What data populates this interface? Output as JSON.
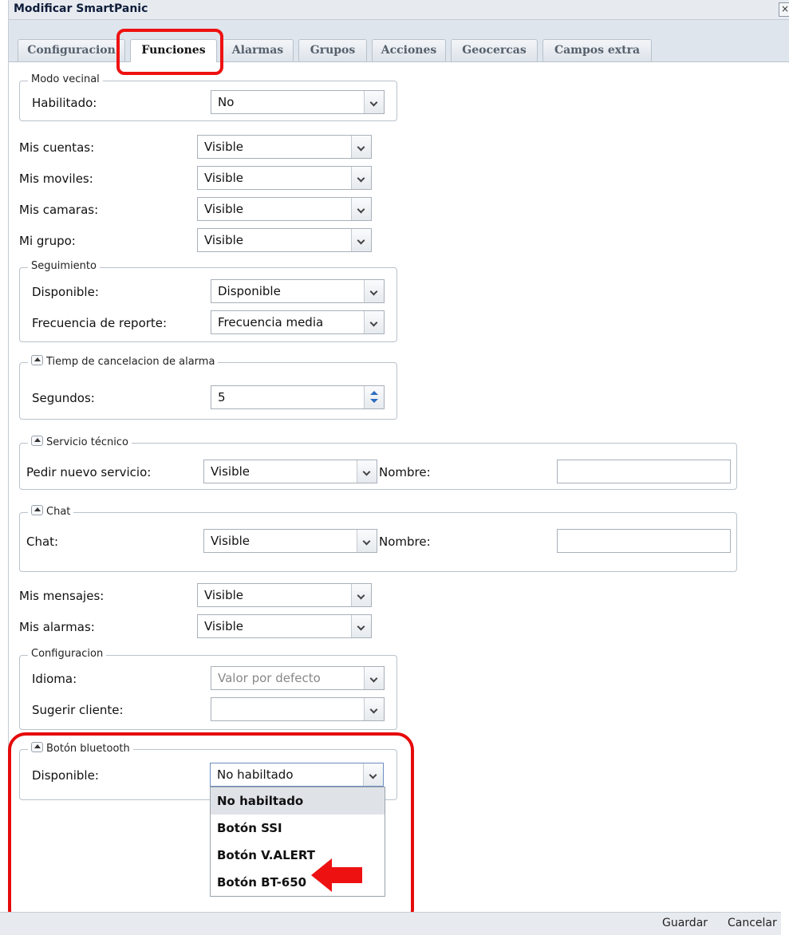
{
  "window": {
    "title": "Modificar SmartPanic",
    "close_label": "×"
  },
  "tabs": [
    {
      "label": "Configuracion"
    },
    {
      "label": "Funciones",
      "active": true
    },
    {
      "label": "Alarmas"
    },
    {
      "label": "Grupos"
    },
    {
      "label": "Acciones"
    },
    {
      "label": "Geocercas"
    },
    {
      "label": "Campos extra"
    }
  ],
  "modo_vecinal": {
    "legend": "Modo vecinal",
    "habilitado_label": "Habilitado:",
    "habilitado_value": "No"
  },
  "mis": {
    "cuentas_label": "Mis cuentas:",
    "cuentas_value": "Visible",
    "moviles_label": "Mis moviles:",
    "moviles_value": "Visible",
    "camaras_label": "Mis camaras:",
    "camaras_value": "Visible",
    "grupo_label": "Mi grupo:",
    "grupo_value": "Visible"
  },
  "seguimiento": {
    "legend": "Seguimiento",
    "disponible_label": "Disponible:",
    "disponible_value": "Disponible",
    "frecuencia_label": "Frecuencia de reporte:",
    "frecuencia_value": "Frecuencia media"
  },
  "cancelacion": {
    "legend": "Tiemp de cancelacion de alarma",
    "segundos_label": "Segundos:",
    "segundos_value": "5"
  },
  "servicio_tecnico": {
    "legend": "Servicio técnico",
    "pedir_label": "Pedir nuevo servicio:",
    "pedir_value": "Visible",
    "nombre_label": "Nombre:",
    "nombre_value": ""
  },
  "chat": {
    "legend": "Chat",
    "chat_label": "Chat:",
    "chat_value": "Visible",
    "nombre_label": "Nombre:",
    "nombre_value": ""
  },
  "mensajes": {
    "mensajes_label": "Mis mensajes:",
    "mensajes_value": "Visible",
    "alarmas_label": "Mis alarmas:",
    "alarmas_value": "Visible"
  },
  "configuracion": {
    "legend": "Configuracion",
    "idioma_label": "Idioma:",
    "idioma_placeholder": "Valor por defecto",
    "sugerir_label": "Sugerir cliente:",
    "sugerir_value": ""
  },
  "boton_bluetooth": {
    "legend": "Botón bluetooth",
    "disponible_label": "Disponible:",
    "disponible_value": "No habiltado",
    "options": [
      "No habiltado",
      "Botón SSI",
      "Botón V.ALERT",
      "Botón BT-650"
    ]
  },
  "footer": {
    "guardar": "Guardar",
    "cancelar": "Cancelar"
  },
  "colors": {
    "highlight": "#ee1111",
    "title_text": "#0f1e3a"
  }
}
